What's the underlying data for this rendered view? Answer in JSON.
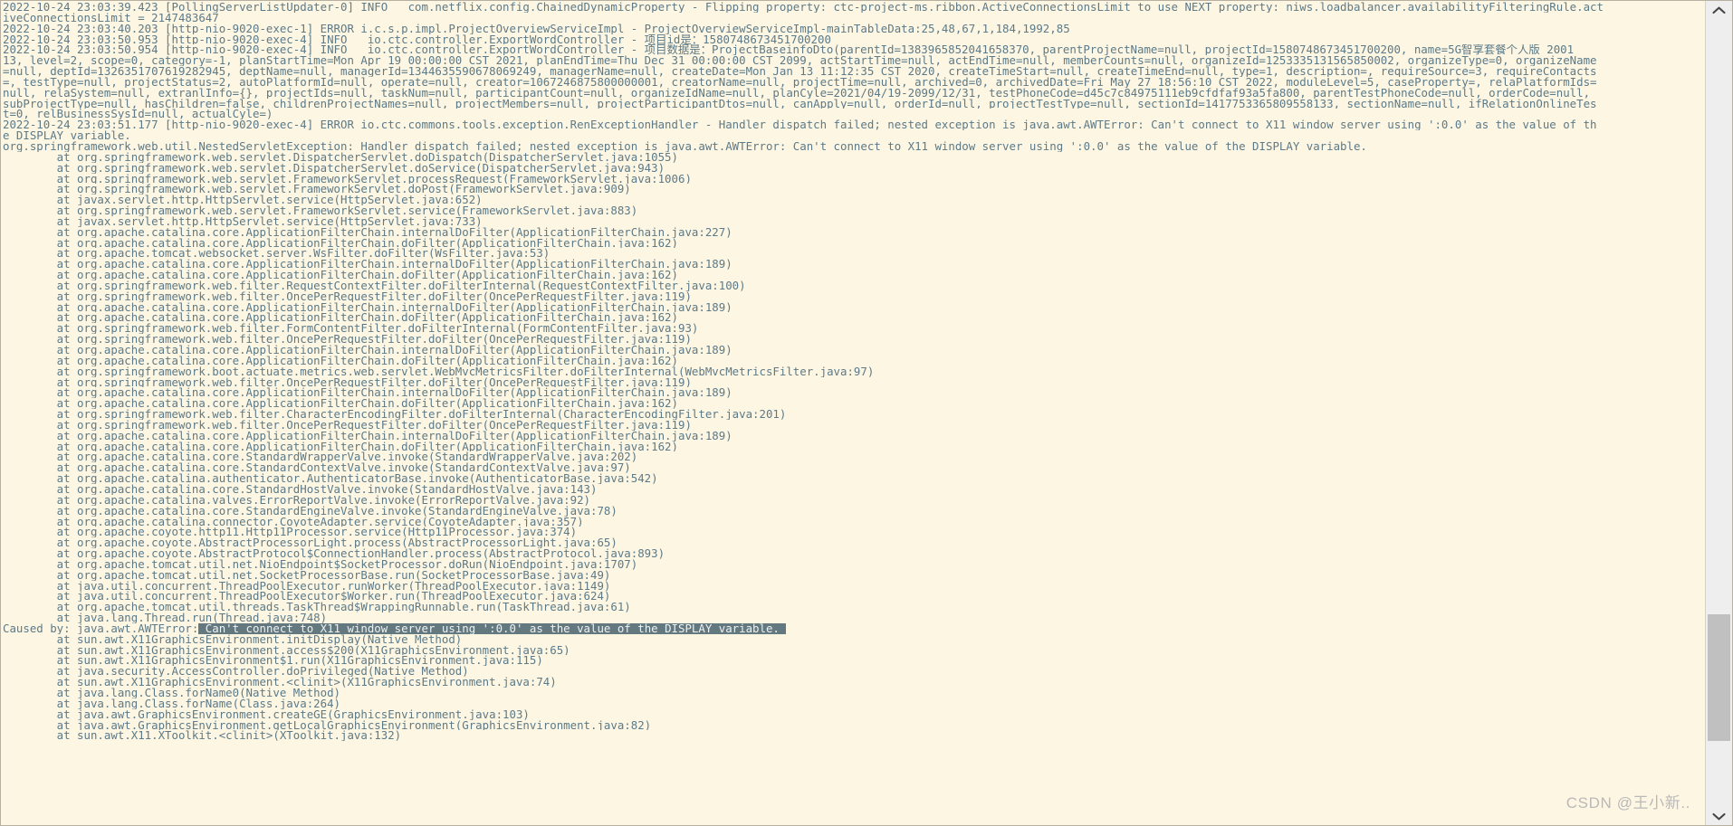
{
  "window": {
    "title": "Log Console",
    "background_color": "#fdf6e3",
    "text_color": "#5c7a88",
    "highlight_background": "#63787f",
    "highlight_text_color": "#eef2f3"
  },
  "watermark": {
    "text": "CSDN @王小新.."
  },
  "scrollbar": {
    "up_arrow_icon": "chevron-up-icon",
    "down_arrow_icon": "chevron-down-icon",
    "thumb_label": "scrollbar-thumb"
  },
  "log": {
    "lines": [
      "2022-10-24 23:03:39.423 [PollingServerListUpdater-0] INFO   com.netflix.config.ChainedDynamicProperty - Flipping property: ctc-project-ms.ribbon.ActiveConnectionsLimit to use NEXT property: niws.loadbalancer.availabilityFilteringRule.act",
      "iveConnectionsLimit = 2147483647",
      "2022-10-24 23:03:40.203 [http-nio-9020-exec-1] ERROR i.c.s.p.impl.ProjectOverviewServiceImpl - ProjectOverviewServiceImpl-mainTableData:25,48,67,1,184,1992,85",
      "2022-10-24 23:03:50.953 [http-nio-9020-exec-4] INFO   io.ctc.controller.ExportWordController - 项目id是：1580748673451700200",
      "2022-10-24 23:03:50.954 [http-nio-9020-exec-4] INFO   io.ctc.controller.ExportWordController - 项目数据是：ProjectBaseinfoDto(parentId=1383965852041658370, parentProjectName=null, projectId=1580748673451700200, name=5G智享套餐个人版_2001",
      "13, level=2, scope=0, category=-1, planStartTime=Mon Apr 19 00:00:00 CST 2021, planEndTime=Thu Dec 31 00:00:00 CST 2099, actStartTime=null, actEndTime=null, memberCounts=null, organizeId=1253335131565850002, organizeType=0, organizeName",
      "=null, deptId=1326351707619282945, deptName=null, managerId=1344635590678069249, managerName=null, createDate=Mon Jan 13 11:12:35 CST 2020, createTimeStart=null, createTimeEnd=null, type=1, description=, requireSource=3, requireContacts",
      "=, testType=null, projectStatus=2, autoPlatformId=null, operate=null, creator=1067246875800000001, creatorName=null, projectTime=null, archived=0, archivedDate=Fri May 27 18:56:10 CST 2022, moduleLevel=5, caseProperty=, relaPlatformIds=",
      "null, relaSystem=null, extranlInfo={}, projectIds=null, taskNum=null, participantCount=null, organizeIdName=null, planCyle=2021/04/19-2099/12/31, testPhoneCode=d45c7c84975111eb9cfdfaf93a5fa800, parentTestPhoneCode=null, orderCode=null,",
      "subProjectType=null, hasChildren=false, childrenProjectNames=null, projectMembers=null, projectParticipantDtos=null, canApply=null, orderId=null, projectTestType=null, sectionId=1417753365809558133, sectionName=null, ifRelationOnlineTes",
      "t=0, relBusinessSysId=null, actualCyle=)",
      "2022-10-24 23:03:51.177 [http-nio-9020-exec-4] ERROR io.ctc.commons.tools.exception.RenExceptionHandler - Handler dispatch failed; nested exception is java.awt.AWTError: Can't connect to X11 window server using ':0.0' as the value of th",
      "e DISPLAY variable.",
      "org.springframework.web.util.NestedServletException: Handler dispatch failed; nested exception is java.awt.AWTError: Can't connect to X11 window server using ':0.0' as the value of the DISPLAY variable.",
      "        at org.springframework.web.servlet.DispatcherServlet.doDispatch(DispatcherServlet.java:1055)",
      "        at org.springframework.web.servlet.DispatcherServlet.doService(DispatcherServlet.java:943)",
      "        at org.springframework.web.servlet.FrameworkServlet.processRequest(FrameworkServlet.java:1006)",
      "        at org.springframework.web.servlet.FrameworkServlet.doPost(FrameworkServlet.java:909)",
      "        at javax.servlet.http.HttpServlet.service(HttpServlet.java:652)",
      "        at org.springframework.web.servlet.FrameworkServlet.service(FrameworkServlet.java:883)",
      "        at javax.servlet.http.HttpServlet.service(HttpServlet.java:733)",
      "        at org.apache.catalina.core.ApplicationFilterChain.internalDoFilter(ApplicationFilterChain.java:227)",
      "        at org.apache.catalina.core.ApplicationFilterChain.doFilter(ApplicationFilterChain.java:162)",
      "        at org.apache.tomcat.websocket.server.WsFilter.doFilter(WsFilter.java:53)",
      "        at org.apache.catalina.core.ApplicationFilterChain.internalDoFilter(ApplicationFilterChain.java:189)",
      "        at org.apache.catalina.core.ApplicationFilterChain.doFilter(ApplicationFilterChain.java:162)",
      "        at org.springframework.web.filter.RequestContextFilter.doFilterInternal(RequestContextFilter.java:100)",
      "        at org.springframework.web.filter.OncePerRequestFilter.doFilter(OncePerRequestFilter.java:119)",
      "        at org.apache.catalina.core.ApplicationFilterChain.internalDoFilter(ApplicationFilterChain.java:189)",
      "        at org.apache.catalina.core.ApplicationFilterChain.doFilter(ApplicationFilterChain.java:162)",
      "        at org.springframework.web.filter.FormContentFilter.doFilterInternal(FormContentFilter.java:93)",
      "        at org.springframework.web.filter.OncePerRequestFilter.doFilter(OncePerRequestFilter.java:119)",
      "        at org.apache.catalina.core.ApplicationFilterChain.internalDoFilter(ApplicationFilterChain.java:189)",
      "        at org.apache.catalina.core.ApplicationFilterChain.doFilter(ApplicationFilterChain.java:162)",
      "        at org.springframework.boot.actuate.metrics.web.servlet.WebMvcMetricsFilter.doFilterInternal(WebMvcMetricsFilter.java:97)",
      "        at org.springframework.web.filter.OncePerRequestFilter.doFilter(OncePerRequestFilter.java:119)",
      "        at org.apache.catalina.core.ApplicationFilterChain.internalDoFilter(ApplicationFilterChain.java:189)",
      "        at org.apache.catalina.core.ApplicationFilterChain.doFilter(ApplicationFilterChain.java:162)",
      "        at org.springframework.web.filter.CharacterEncodingFilter.doFilterInternal(CharacterEncodingFilter.java:201)",
      "        at org.springframework.web.filter.OncePerRequestFilter.doFilter(OncePerRequestFilter.java:119)",
      "        at org.apache.catalina.core.ApplicationFilterChain.internalDoFilter(ApplicationFilterChain.java:189)",
      "        at org.apache.catalina.core.ApplicationFilterChain.doFilter(ApplicationFilterChain.java:162)",
      "        at org.apache.catalina.core.StandardWrapperValve.invoke(StandardWrapperValve.java:202)",
      "        at org.apache.catalina.core.StandardContextValve.invoke(StandardContextValve.java:97)",
      "        at org.apache.catalina.authenticator.AuthenticatorBase.invoke(AuthenticatorBase.java:542)",
      "        at org.apache.catalina.core.StandardHostValve.invoke(StandardHostValve.java:143)",
      "        at org.apache.catalina.valves.ErrorReportValve.invoke(ErrorReportValve.java:92)",
      "        at org.apache.catalina.core.StandardEngineValve.invoke(StandardEngineValve.java:78)",
      "        at org.apache.catalina.connector.CoyoteAdapter.service(CoyoteAdapter.java:357)",
      "        at org.apache.coyote.http11.Http11Processor.service(Http11Processor.java:374)",
      "        at org.apache.coyote.AbstractProcessorLight.process(AbstractProcessorLight.java:65)",
      "        at org.apache.coyote.AbstractProtocol$ConnectionHandler.process(AbstractProtocol.java:893)",
      "        at org.apache.tomcat.util.net.NioEndpoint$SocketProcessor.doRun(NioEndpoint.java:1707)",
      "        at org.apache.tomcat.util.net.SocketProcessorBase.run(SocketProcessorBase.java:49)",
      "        at java.util.concurrent.ThreadPoolExecutor.runWorker(ThreadPoolExecutor.java:1149)",
      "        at java.util.concurrent.ThreadPoolExecutor$Worker.run(ThreadPoolExecutor.java:624)",
      "        at org.apache.tomcat.util.threads.TaskThread$WrappingRunnable.run(TaskThread.java:61)",
      "        at java.lang.Thread.run(Thread.java:748)",
      "        at sun.awt.X11GraphicsEnvironment.initDisplay(Native Method)",
      "        at sun.awt.X11GraphicsEnvironment.access$200(X11GraphicsEnvironment.java:65)",
      "        at sun.awt.X11GraphicsEnvironment$1.run(X11GraphicsEnvironment.java:115)",
      "        at java.security.AccessController.doPrivileged(Native Method)",
      "        at sun.awt.X11GraphicsEnvironment.<clinit>(X11GraphicsEnvironment.java:74)",
      "        at java.lang.Class.forName0(Native Method)",
      "        at java.lang.Class.forName(Class.java:264)",
      "        at java.awt.GraphicsEnvironment.createGE(GraphicsEnvironment.java:103)",
      "        at java.awt.GraphicsEnvironment.getLocalGraphicsEnvironment(GraphicsEnvironment.java:82)",
      "        at sun.awt.X11.XToolkit.<clinit>(XToolkit.java:132)"
    ],
    "caused_by_line": {
      "index": 58,
      "prefix": "Caused by: java.awt.AWTError:",
      "highlighted": " Can't connect to X11 window server using ':0.0' as the value of the DISPLAY variable. "
    }
  }
}
